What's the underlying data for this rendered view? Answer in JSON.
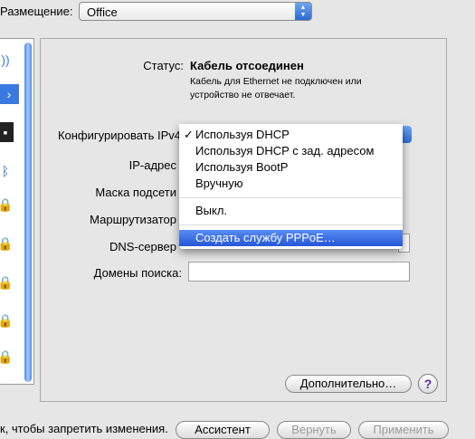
{
  "location": {
    "label": "Размещение:",
    "value": "Office"
  },
  "status": {
    "label": "Статус:",
    "value": "Кабель отсоединен",
    "desc_line1": "Кабель для Ethernet не подключен или",
    "desc_line2": "устройство не отвечает."
  },
  "form": {
    "configure_label": "Конфигурировать IPv4",
    "ip_label": "IP-адрес",
    "mask_label": "Маска подсети",
    "router_label": "Маршрутизатор",
    "dns_label": "DNS-сервер",
    "search_label": "Домены поиска:"
  },
  "menu": {
    "items": [
      {
        "label": "Используя DHCP",
        "checked": true
      },
      {
        "label": "Используя DHCP с зад. адресом"
      },
      {
        "label": "Используя BootP"
      },
      {
        "label": "Вручную"
      },
      {
        "label": "Выкл."
      },
      {
        "label": "Создать службу PPPoE…",
        "highlighted": true
      }
    ],
    "check_mark": "✓"
  },
  "buttons": {
    "advanced": "Дополнительно…",
    "help": "?",
    "assistant": "Ассистент",
    "revert": "Вернуть",
    "apply": "Применить"
  },
  "bottom": {
    "lock_text": "к, чтобы запретить изменения."
  },
  "colors": {
    "accent": "#2557d8",
    "background": "#e6e6e6"
  }
}
